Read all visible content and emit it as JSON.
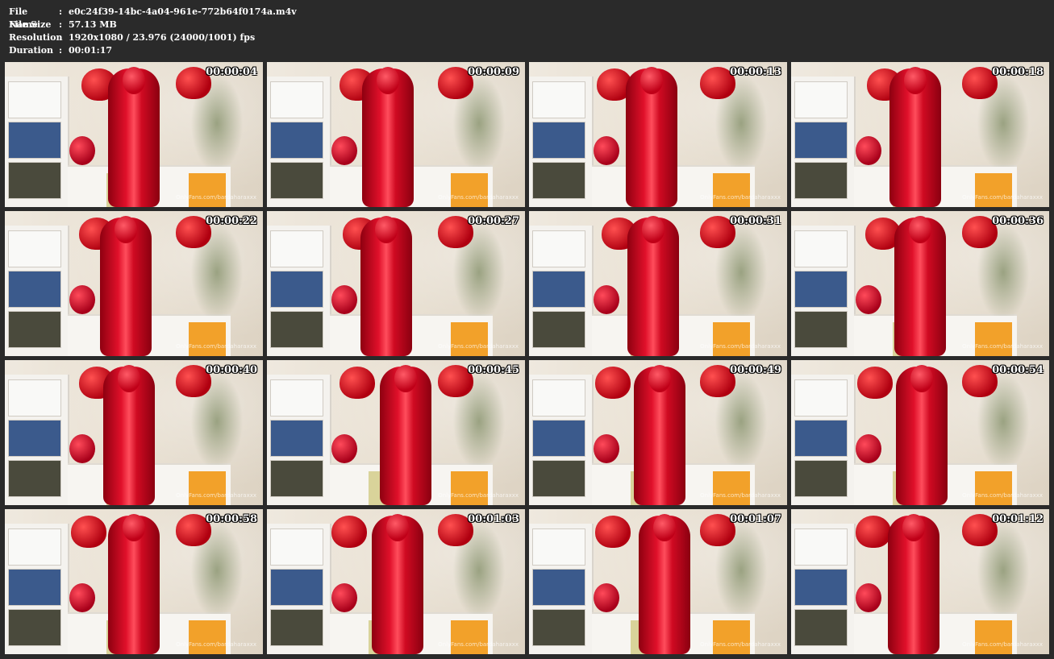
{
  "info": {
    "file_name_label": "File Name",
    "file_name_value": "e0c24f39-14bc-4a04-961e-772b64f0174a.m4v",
    "file_size_label": "File Size",
    "file_size_value": "57.13 MB",
    "resolution_label": "Resolution",
    "resolution_value": "1920x1080 / 23.976 (24000/1001) fps",
    "duration_label": "Duration",
    "duration_value": "00:01:17",
    "separator": ":"
  },
  "thumbnails": [
    {
      "timecode": "00:00:04"
    },
    {
      "timecode": "00:00:09"
    },
    {
      "timecode": "00:00:13"
    },
    {
      "timecode": "00:00:18"
    },
    {
      "timecode": "00:00:22"
    },
    {
      "timecode": "00:00:27"
    },
    {
      "timecode": "00:00:31"
    },
    {
      "timecode": "00:00:36"
    },
    {
      "timecode": "00:00:40"
    },
    {
      "timecode": "00:00:45"
    },
    {
      "timecode": "00:00:49"
    },
    {
      "timecode": "00:00:54"
    },
    {
      "timecode": "00:00:58"
    },
    {
      "timecode": "00:01:03"
    },
    {
      "timecode": "00:01:07"
    },
    {
      "timecode": "00:01:12"
    }
  ],
  "watermark_text": "OnlyFans.com/bardaharaxxx"
}
